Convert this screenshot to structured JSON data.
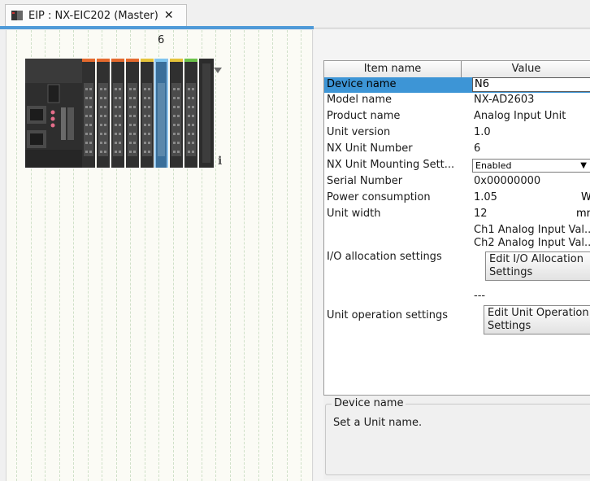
{
  "tab": {
    "title": "EIP : NX-EIC202 (Master)",
    "close": "✕"
  },
  "rack": {
    "slot_number": "6"
  },
  "properties": {
    "headers": {
      "item_name": "Item name",
      "value": "Value"
    },
    "rows": [
      {
        "name": "Device name",
        "value": "N6"
      },
      {
        "name": "Model name",
        "value": "NX-AD2603"
      },
      {
        "name": "Product name",
        "value": "Analog Input Unit"
      },
      {
        "name": "Unit version",
        "value": "1.0"
      },
      {
        "name": "NX Unit Number",
        "value": "6"
      },
      {
        "name": "NX Unit Mounting Sett...",
        "value": "Enabled"
      },
      {
        "name": "Serial Number",
        "value": "0x00000000"
      },
      {
        "name": "Power consumption",
        "value": "1.05",
        "unit": "W"
      },
      {
        "name": "Unit width",
        "value": "12",
        "unit": "mm"
      }
    ],
    "io_allocation": {
      "name": "I/O allocation settings",
      "values": [
        "Ch1 Analog Input Val...",
        "Ch2 Analog Input Val..."
      ],
      "button": "Edit I/O Allocation\nSettings"
    },
    "unit_operation": {
      "name": "Unit operation settings",
      "value": "---",
      "button": "Edit Unit Operation\nSettings"
    }
  },
  "description": {
    "title": "Device name",
    "text": "Set a Unit name."
  },
  "colors": {
    "selection": "#3d95d6",
    "tab_accent": "#4f9ad8"
  }
}
